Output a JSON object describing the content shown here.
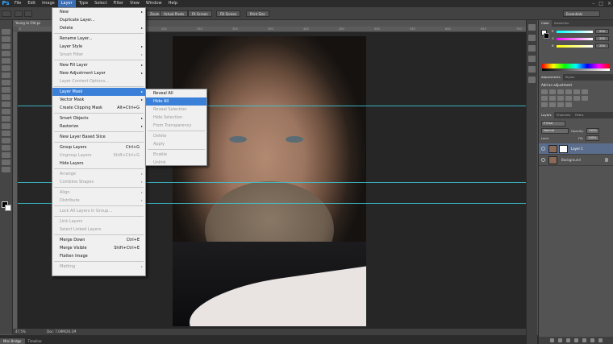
{
  "menubar": {
    "logo": "Ps",
    "items": [
      "File",
      "Edit",
      "Image",
      "Layer",
      "Type",
      "Select",
      "Filter",
      "View",
      "Window",
      "Help"
    ],
    "active_index": 3,
    "window_controls": [
      "–",
      "□",
      "×"
    ]
  },
  "optionsbar": {
    "zoom_buttons": [
      "Zoom",
      "Actual Pixels",
      "Fit Screen",
      "Fill Screen",
      "Print Size"
    ],
    "workspace": "Essentials"
  },
  "document": {
    "tab_title": "Young to Old.psd @",
    "zoom": "47.5%",
    "doc_size": "Doc: 7.09M/26.1M",
    "ruler_numbers": [
      "0",
      "50",
      "100",
      "150",
      "200",
      "250",
      "300",
      "350",
      "400",
      "450",
      "500",
      "550",
      "600",
      "650",
      "700"
    ]
  },
  "layer_menu": {
    "items": [
      {
        "label": "New",
        "arrow": true
      },
      {
        "label": "Duplicate Layer..."
      },
      {
        "label": "Delete",
        "arrow": true
      },
      {
        "sep": true
      },
      {
        "label": "Rename Layer..."
      },
      {
        "label": "Layer Style",
        "arrow": true
      },
      {
        "label": "Smart Filter",
        "disabled": true,
        "arrow": true
      },
      {
        "sep": true
      },
      {
        "label": "New Fill Layer",
        "arrow": true
      },
      {
        "label": "New Adjustment Layer",
        "arrow": true
      },
      {
        "label": "Layer Content Options...",
        "disabled": true
      },
      {
        "sep": true
      },
      {
        "label": "Layer Mask",
        "arrow": true,
        "highlighted": true
      },
      {
        "label": "Vector Mask",
        "arrow": true
      },
      {
        "label": "Create Clipping Mask",
        "shortcut": "Alt+Ctrl+G"
      },
      {
        "sep": true
      },
      {
        "label": "Smart Objects",
        "arrow": true
      },
      {
        "label": "Rasterize",
        "arrow": true
      },
      {
        "sep": true
      },
      {
        "label": "New Layer Based Slice"
      },
      {
        "sep": true
      },
      {
        "label": "Group Layers",
        "shortcut": "Ctrl+G"
      },
      {
        "label": "Ungroup Layers",
        "shortcut": "Shift+Ctrl+G",
        "disabled": true
      },
      {
        "label": "Hide Layers"
      },
      {
        "sep": true
      },
      {
        "label": "Arrange",
        "arrow": true,
        "disabled": true
      },
      {
        "label": "Combine Shapes",
        "arrow": true,
        "disabled": true
      },
      {
        "sep": true
      },
      {
        "label": "Align",
        "arrow": true,
        "disabled": true
      },
      {
        "label": "Distribute",
        "arrow": true,
        "disabled": true
      },
      {
        "sep": true
      },
      {
        "label": "Lock All Layers in Group...",
        "disabled": true
      },
      {
        "sep": true
      },
      {
        "label": "Link Layers",
        "disabled": true
      },
      {
        "label": "Select Linked Layers",
        "disabled": true
      },
      {
        "sep": true
      },
      {
        "label": "Merge Down",
        "shortcut": "Ctrl+E"
      },
      {
        "label": "Merge Visible",
        "shortcut": "Shift+Ctrl+E"
      },
      {
        "label": "Flatten Image"
      },
      {
        "sep": true
      },
      {
        "label": "Matting",
        "arrow": true,
        "disabled": true
      }
    ]
  },
  "layer_mask_submenu": {
    "items": [
      {
        "label": "Reveal All"
      },
      {
        "label": "Hide All",
        "highlighted": true
      },
      {
        "label": "Reveal Selection",
        "disabled": true
      },
      {
        "label": "Hide Selection",
        "disabled": true
      },
      {
        "label": "From Transparency",
        "disabled": true
      },
      {
        "sep": true
      },
      {
        "label": "Delete",
        "disabled": true
      },
      {
        "label": "Apply",
        "disabled": true
      },
      {
        "sep": true
      },
      {
        "label": "Enable",
        "disabled": true
      },
      {
        "label": "Unlink",
        "disabled": true
      }
    ]
  },
  "color_panel": {
    "tabs": [
      "Color",
      "Swatches"
    ],
    "sliders": [
      {
        "label": "R",
        "value": "255",
        "color": "#ff4040"
      },
      {
        "label": "G",
        "value": "255",
        "color": "#40ff40"
      },
      {
        "label": "B",
        "value": "255",
        "color": "#4060ff"
      }
    ]
  },
  "adjustments_panel": {
    "tabs": [
      "Adjustments",
      "Styles"
    ],
    "title": "Add an adjustment"
  },
  "layers_panel": {
    "tabs": [
      "Layers",
      "Channels",
      "Paths"
    ],
    "kind": "P Kind",
    "blend_mode": "Normal",
    "opacity_label": "Opacity:",
    "opacity": "100%",
    "lock_label": "Lock:",
    "fill_label": "Fill:",
    "fill": "100%",
    "layers": [
      {
        "name": "Layer 1",
        "selected": true,
        "mask": true
      },
      {
        "name": "Background",
        "selected": false,
        "locked": true
      }
    ]
  },
  "bottom_tabs": [
    "Mini Bridge",
    "Timeline"
  ],
  "colors": {
    "accent": "#3a80d9",
    "guide": "#3ec7d6",
    "selected_layer": "#5b6d8c"
  }
}
